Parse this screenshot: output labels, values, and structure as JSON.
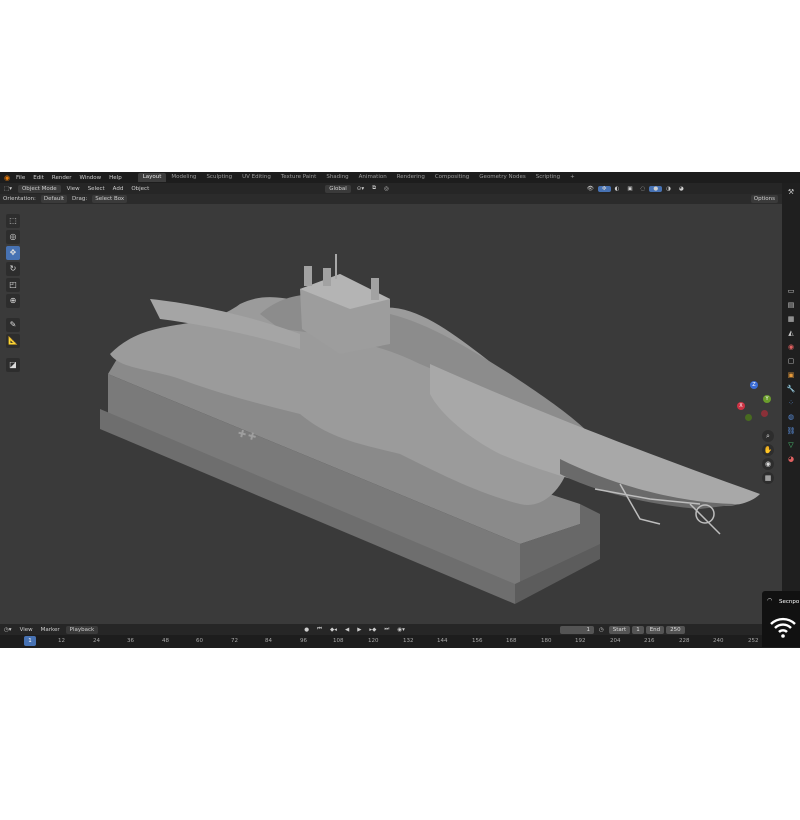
{
  "menu": {
    "file": "File",
    "edit": "Edit",
    "render": "Render",
    "window": "Window",
    "help": "Help"
  },
  "workspace_tabs": [
    "Layout",
    "Modeling",
    "Sculpting",
    "UV Editing",
    "Texture Paint",
    "Shading",
    "Animation",
    "Rendering",
    "Compositing",
    "Geometry Nodes",
    "Scripting"
  ],
  "active_tab": "Layout",
  "viewport_header": {
    "mode": "Object Mode",
    "view": "View",
    "select": "Select",
    "add": "Add",
    "object": "Object",
    "transform": "Global"
  },
  "tool_settings": {
    "orientation_label": "Orientation:",
    "orientation_value": "Default",
    "drag_label": "Drag:",
    "drag_value": "Select Box",
    "options": "Options"
  },
  "toolbar": [
    "select-box",
    "cursor",
    "move",
    "rotate",
    "scale",
    "transform",
    "annotate",
    "measure",
    "add-cube"
  ],
  "active_tool": "move",
  "gizmo": {
    "x": "X",
    "y": "Y",
    "z": "Z"
  },
  "model_text": "ᐩᐩ",
  "timeline": {
    "view": "View",
    "marker": "Marker",
    "playback": "Playback",
    "current_frame": "1",
    "start_label": "Start",
    "start_value": "1",
    "end_label": "End",
    "end_value": "250"
  },
  "frame_ticks": [
    "1",
    "12",
    "24",
    "36",
    "48",
    "60",
    "72",
    "84",
    "96",
    "108",
    "120",
    "132",
    "144",
    "156",
    "168",
    "180",
    "192",
    "204",
    "216",
    "228",
    "240",
    "252"
  ],
  "notification": {
    "text": "Secnpo"
  },
  "colors": {
    "accent": "#4772b3",
    "viewport": "#3a3a3a",
    "header": "#262626",
    "model": "#8e8e8e"
  }
}
